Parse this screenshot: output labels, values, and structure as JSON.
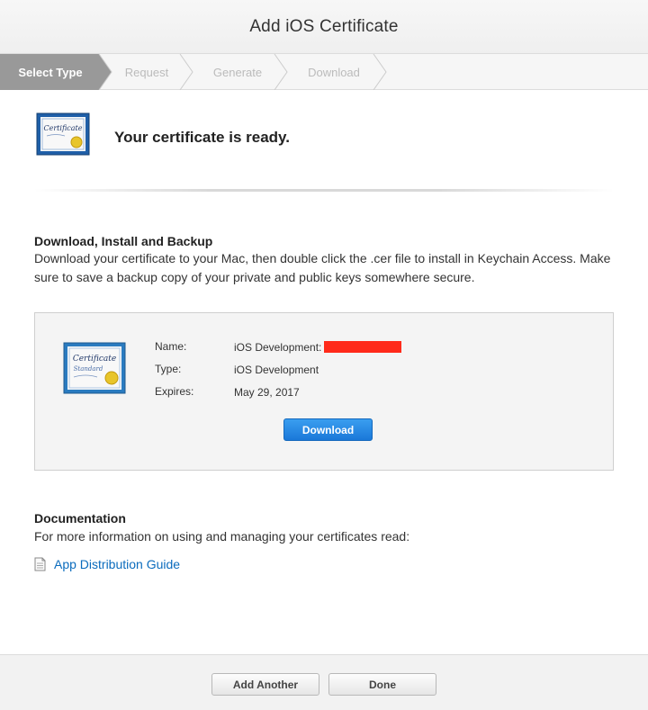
{
  "header": {
    "title": "Add iOS Certificate"
  },
  "steps": [
    {
      "label": "Select Type",
      "active": true
    },
    {
      "label": "Request",
      "active": false
    },
    {
      "label": "Generate",
      "active": false
    },
    {
      "label": "Download",
      "active": false
    }
  ],
  "hero": {
    "message": "Your certificate is ready.",
    "icon": "certificate-icon"
  },
  "download_section": {
    "title": "Download, Install and Backup",
    "text": "Download your certificate to your Mac, then double click the .cer file to install in Keychain Access. Make sure to save a backup copy of your private and public keys somewhere secure."
  },
  "certificate": {
    "name_label": "Name:",
    "name_value": "iOS Development:",
    "type_label": "Type:",
    "type_value": "iOS Development",
    "expires_label": "Expires:",
    "expires_value": "May 29, 2017",
    "download_label": "Download"
  },
  "documentation": {
    "title": "Documentation",
    "text": "For more information on using and managing your certificates read:",
    "link_label": "App Distribution Guide"
  },
  "footer": {
    "add_another_label": "Add Another",
    "done_label": "Done"
  },
  "colors": {
    "accent": "#1a78d8",
    "link": "#0a6bbd",
    "active_step": "#999999",
    "redaction": "#ff2a1a"
  }
}
